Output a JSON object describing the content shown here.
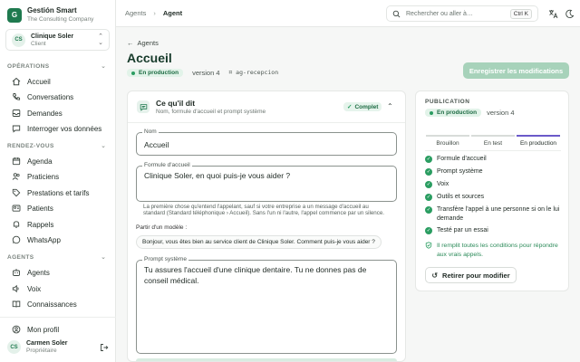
{
  "brand": {
    "name": "Gestión Smart",
    "subtitle": "The Consulting Company",
    "logo_letter": "G"
  },
  "client": {
    "initials": "CS",
    "name": "Clinique Soler",
    "role": "Client"
  },
  "sidebar": {
    "sections": [
      {
        "label": "OPÉRATIONS",
        "items": [
          {
            "label": "Accueil",
            "icon": "home-icon"
          },
          {
            "label": "Conversations",
            "icon": "phone-icon"
          },
          {
            "label": "Demandes",
            "icon": "inbox-icon"
          },
          {
            "label": "Interroger vos données",
            "icon": "chat-icon"
          }
        ]
      },
      {
        "label": "RENDEZ-VOUS",
        "items": [
          {
            "label": "Agenda",
            "icon": "calendar-icon"
          },
          {
            "label": "Praticiens",
            "icon": "users-icon"
          },
          {
            "label": "Prestations et tarifs",
            "icon": "tag-icon"
          },
          {
            "label": "Patients",
            "icon": "contact-card-icon"
          },
          {
            "label": "Rappels",
            "icon": "bell-icon"
          },
          {
            "label": "WhatsApp",
            "icon": "whatsapp-icon"
          }
        ]
      },
      {
        "label": "AGENTS",
        "items": [
          {
            "label": "Agents",
            "icon": "robot-icon"
          },
          {
            "label": "Voix",
            "icon": "speaker-icon"
          },
          {
            "label": "Connaissances",
            "icon": "book-icon"
          }
        ]
      }
    ],
    "profile_label": "Mon profil",
    "user": {
      "initials": "CS",
      "name": "Carmen Soler",
      "role": "Propriétaire"
    }
  },
  "topbar": {
    "breadcrumb": [
      "Agents",
      "Agent"
    ],
    "search_placeholder": "Rechercher ou aller à…",
    "search_shortcut": "Ctrl K"
  },
  "page": {
    "back_label": "Agents",
    "title": "Accueil",
    "status": "En production",
    "version": "version 4",
    "agent_id": "ag-recepcion",
    "save_label": "Enregistrer les modifications"
  },
  "card": {
    "title": "Ce qu'il dit",
    "subtitle": "Nom, formule d'accueil et prompt système",
    "status": "Complet",
    "name_label": "Nom",
    "name_value": "Accueil",
    "greeting_label": "Formule d'accueil",
    "greeting_value": "Clinique Soler, en quoi puis-je vous aider ?",
    "greeting_help": "La première chose qu'entend l'appelant, sauf si votre entreprise a un message d'accueil au standard (Standard téléphonique › Accueil). Sans l'un ni l'autre, l'appel commence par un silence.",
    "alt_label": "Partir d'un modèle :",
    "alt_chip": "Bonjour, vous êtes bien au service client de Clinique Soler. Comment puis-je vous aider ?",
    "prompt_label": "Prompt système",
    "prompt_value": "Tu assures l'accueil d'une clinique dentaire. Tu ne donnes pas de conseil médical."
  },
  "publication": {
    "title": "PUBLICATION",
    "status": "En production",
    "version": "version 4",
    "stages": [
      "Brouillon",
      "En test",
      "En production"
    ],
    "active_stage": 2,
    "checks": [
      "Formule d'accueil",
      "Prompt système",
      "Voix",
      "Outils et sources",
      "Transfère l'appel à une personne si on le lui demande",
      "Testé par un essai"
    ],
    "note": "Il remplit toutes les conditions pour répondre aux vrais appels.",
    "withdraw_label": "Retirer pour modifier"
  },
  "colors": {
    "accent": "#1f7a4f",
    "success": "#2a9d61",
    "stage_active": "#6b59c9",
    "save_disabled": "#a7d2ba"
  }
}
